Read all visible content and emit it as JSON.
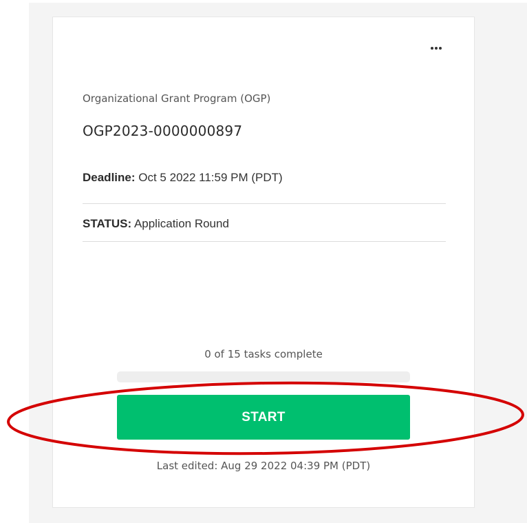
{
  "card": {
    "menu_icon": "more-horizontal-icon",
    "program_name": "Organizational Grant Program (OGP)",
    "application_id": "OGP2023-0000000897",
    "deadline": {
      "label": "Deadline:",
      "value": "Oct 5 2022 11:59 PM (PDT)"
    },
    "status": {
      "label": "STATUS:",
      "value": "Application Round"
    },
    "tasks": {
      "text": "0 of 15 tasks complete",
      "completed": 0,
      "total": 15,
      "progress_fraction": 0
    },
    "start_button_label": "START",
    "last_edited": "Last edited: Aug 29 2022 04:39 PM (PDT)"
  },
  "colors": {
    "accent_green": "#00bf6f",
    "progress_track": "#eeeeee",
    "annotation_red": "#d40000",
    "page_background": "#f4f4f4"
  }
}
